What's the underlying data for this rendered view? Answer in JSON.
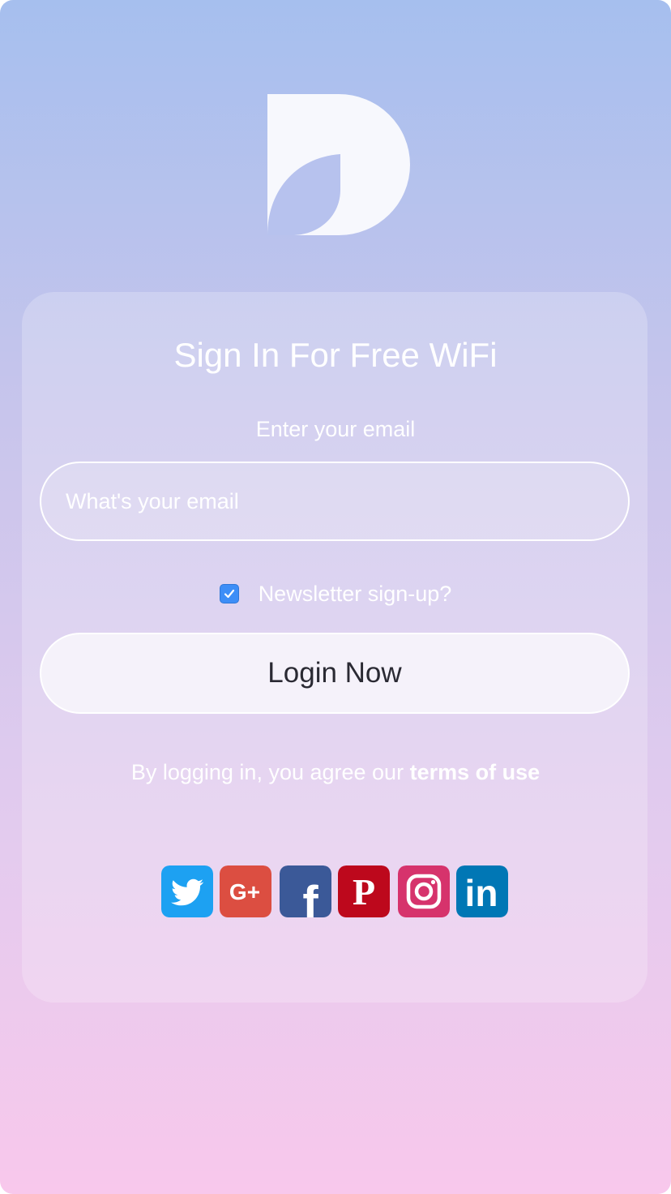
{
  "colors": {
    "checkbox": "#3d8ef7",
    "twitter": "#1da1f2",
    "google_plus": "#dc4e41",
    "facebook": "#3b5998",
    "pinterest": "#bd081c",
    "instagram": "#d6336c",
    "linkedin": "#0077b5"
  },
  "title": "Sign In For Free WiFi",
  "email": {
    "label": "Enter your email",
    "placeholder": "What's your email",
    "value": ""
  },
  "newsletter": {
    "label": "Newsletter sign-up?",
    "checked": true
  },
  "login_button": "Login Now",
  "terms": {
    "prefix": "By logging in, you agree our ",
    "link": "terms of use"
  },
  "social": [
    {
      "name": "twitter",
      "icon": "twitter-icon"
    },
    {
      "name": "google-plus",
      "icon": "google-plus-icon",
      "label": "G+"
    },
    {
      "name": "facebook",
      "icon": "facebook-icon",
      "label": "f"
    },
    {
      "name": "pinterest",
      "icon": "pinterest-icon",
      "label": "P"
    },
    {
      "name": "instagram",
      "icon": "instagram-icon"
    },
    {
      "name": "linkedin",
      "icon": "linkedin-icon",
      "label": "in"
    }
  ]
}
